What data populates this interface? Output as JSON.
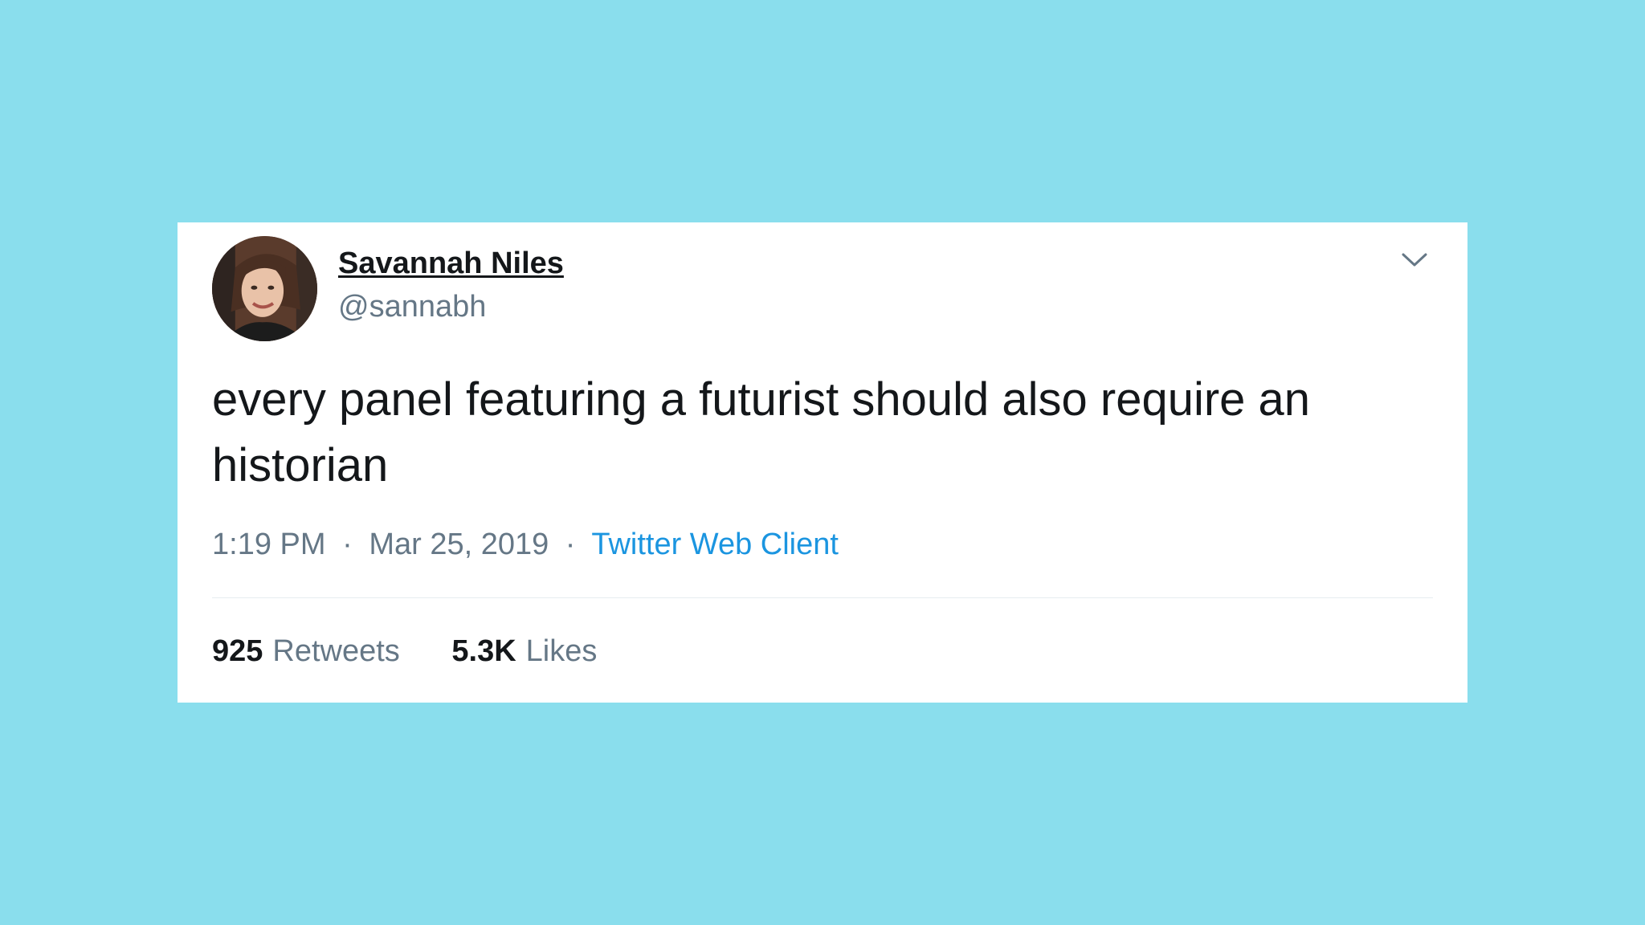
{
  "page": {
    "background_color": "#8adeed"
  },
  "tweet": {
    "author": {
      "display_name": "Savannah Niles",
      "handle": "@sannabh"
    },
    "text": "every panel featuring a futurist should also require an historian",
    "time": "1:19 PM",
    "date": "Mar 25, 2019",
    "separator": "·",
    "client": "Twitter Web Client",
    "stats": {
      "retweets_count": "925",
      "retweets_label": "Retweets",
      "likes_count": "5.3K",
      "likes_label": "Likes"
    }
  },
  "icons": {
    "menu": "chevron-down-icon",
    "avatar": "avatar-photo"
  },
  "colors": {
    "text_primary": "#14171a",
    "text_secondary": "#657786",
    "link": "#1b95e0",
    "card": "#ffffff"
  }
}
